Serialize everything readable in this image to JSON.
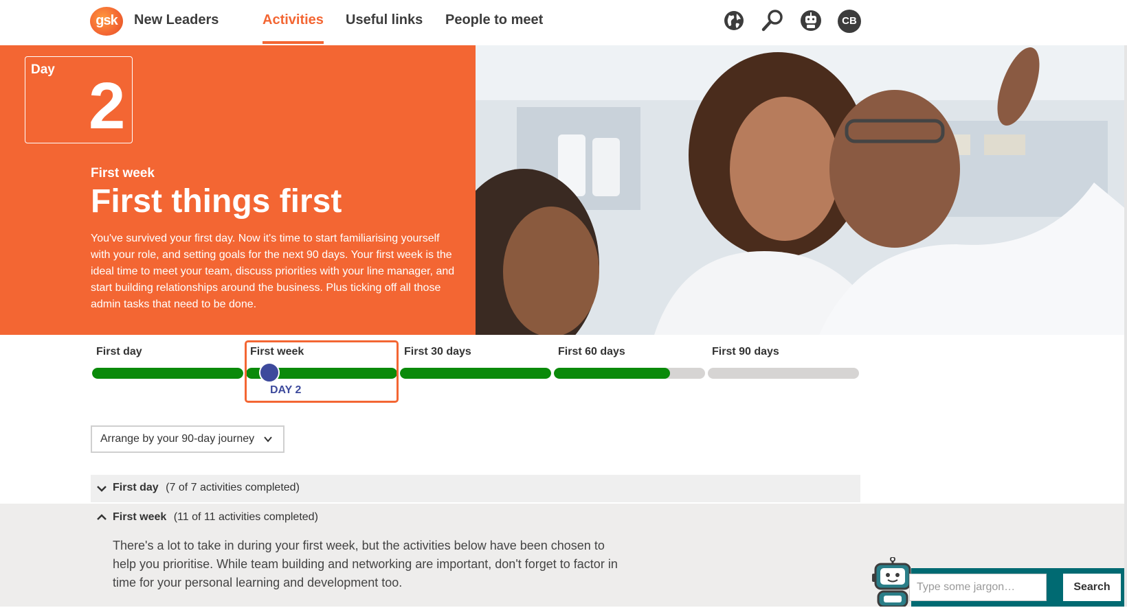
{
  "header": {
    "logo_text": "gsk",
    "app_title": "New Leaders",
    "nav": [
      {
        "label": "Activities",
        "active": true
      },
      {
        "label": "Useful links",
        "active": false
      },
      {
        "label": "People to meet",
        "active": false
      }
    ],
    "icons": [
      "globe-icon",
      "search-icon",
      "robot-icon"
    ],
    "user_initials": "CB"
  },
  "hero": {
    "day_label": "Day",
    "day_number": "2",
    "subtitle": "First week",
    "title": "First things first",
    "description": "You've survived your first day. Now it's time to start familiarising yourself with your role, and setting goals for the next 90 days. Your first week is the ideal time to meet your team, discuss priorities with your line manager, and start building relationships around the business. Plus ticking off all those admin tasks that need to be done."
  },
  "timeline": {
    "phases": [
      {
        "label": "First day",
        "progress": 1.0
      },
      {
        "label": "First week",
        "progress": 1.0,
        "current": true
      },
      {
        "label": "First 30 days",
        "progress": 1.0
      },
      {
        "label": "First 60 days",
        "progress": 0.77
      },
      {
        "label": "First 90 days",
        "progress": 0.0
      }
    ],
    "marker_label": "DAY 2"
  },
  "arrange": {
    "selected": "Arrange by your 90-day journey"
  },
  "accordion": {
    "first_day": {
      "title": "First day",
      "count": "(7 of 7 activities completed)"
    },
    "first_week": {
      "title": "First week",
      "count": "(11 of 11 activities completed)",
      "body": "There's a lot to take in during your first week, but the activities below have been chosen to help you prioritise. While team building and networking are important, don't forget to factor in time for your personal learning and development too."
    }
  },
  "jargon": {
    "placeholder": "Type some jargon…",
    "button_label": "Search"
  },
  "colors": {
    "brand_orange": "#f36633",
    "progress_green": "#0a8a0a",
    "marker_blue": "#3d4a9c",
    "teal": "#006a72"
  }
}
